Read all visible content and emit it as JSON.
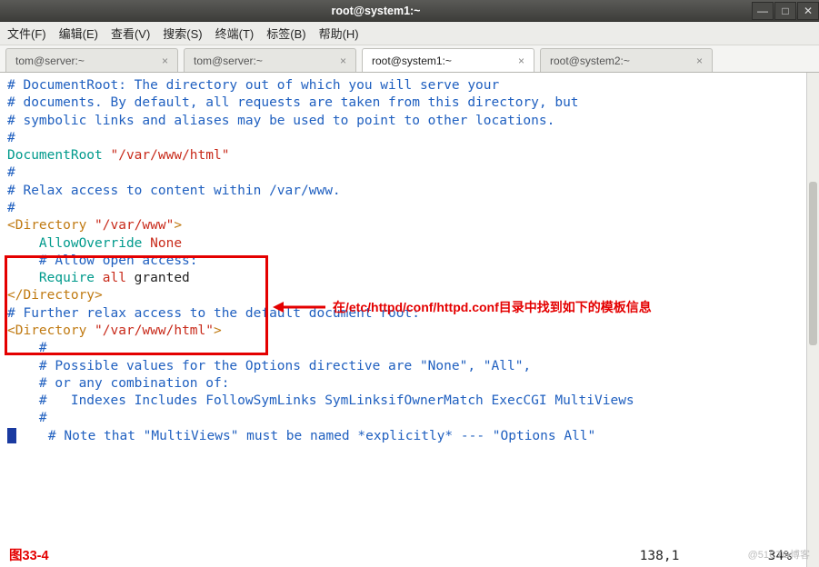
{
  "window": {
    "title": "root@system1:~",
    "min_icon": "—",
    "max_icon": "□",
    "close_icon": "✕"
  },
  "menu": {
    "file": "文件(F)",
    "edit": "编辑(E)",
    "view": "查看(V)",
    "search": "搜索(S)",
    "terminal": "终端(T)",
    "tabs": "标签(B)",
    "help": "帮助(H)"
  },
  "tabs": {
    "t0": "tom@server:~",
    "t1": "tom@server:~",
    "t2": "root@system1:~",
    "t3": "root@system2:~",
    "close": "×"
  },
  "lines": {
    "l1": "# DocumentRoot: The directory out of which you will serve your",
    "l2": "# documents. By default, all requests are taken from this directory, but",
    "l3": "# symbolic links and aliases may be used to point to other locations.",
    "l4": "#",
    "l5a": "DocumentRoot",
    "l5b": " \"/var/www/html\"",
    "l6": "",
    "l7": "#",
    "l8": "# Relax access to content within /var/www.",
    "l9": "#",
    "l10a": "<Directory",
    "l10b": " \"/var/www\"",
    "l10c": ">",
    "l11a": "    AllowOverride",
    "l11b": " None",
    "l12": "    # Allow open access:",
    "l13a": "    Require",
    "l13b": " all",
    "l13c": " granted",
    "l14": "</Directory>",
    "l15": "",
    "l16": "# Further relax access to the default document root:",
    "l17a": "<Directory",
    "l17b": " \"/var/www/html\"",
    "l17c": ">",
    "l18": "    #",
    "l19": "    # Possible values for the Options directive are \"None\", \"All\",",
    "l20": "    # or any combination of:",
    "l21": "    #   Indexes Includes FollowSymLinks SymLinksifOwnerMatch ExecCGI MultiViews",
    "l22": "    #",
    "l23a": "    # Note that \"MultiViews\" must be named *explicitly* --- \"Options All\""
  },
  "annotation": {
    "text": "在/etc/httpd/conf/httpd.conf目录中找到如下的模板信息"
  },
  "caption": {
    "text": "图33-4"
  },
  "status": {
    "pos": "138,1",
    "percent": "34%"
  },
  "watermark": {
    "text": "@51CTO博客"
  }
}
